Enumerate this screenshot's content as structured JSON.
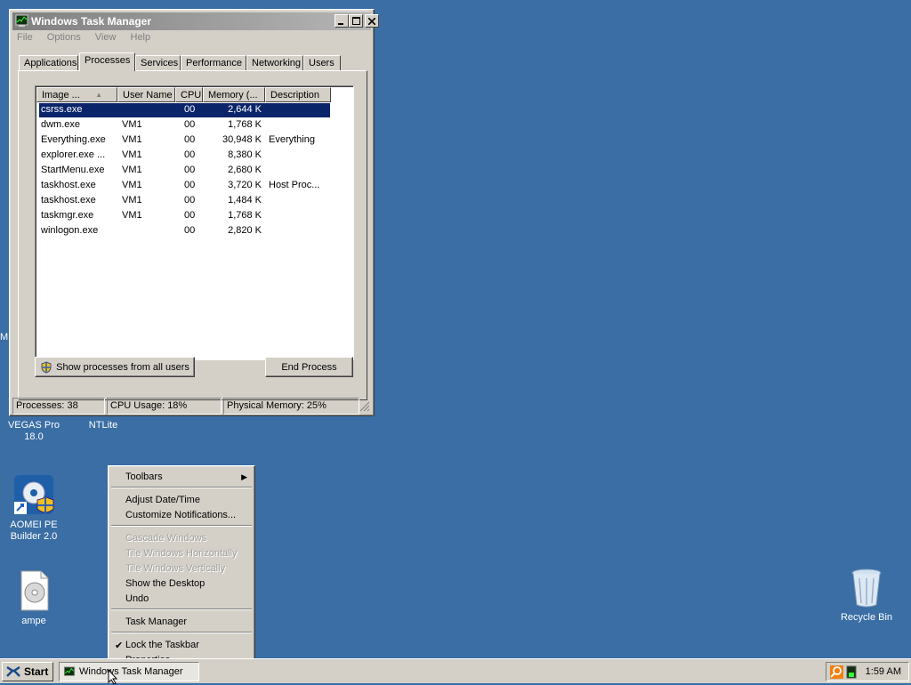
{
  "desktop": {
    "edge_letter": "M",
    "icons": [
      {
        "label_line1": "VEGAS Pro",
        "label_line2": "18.0"
      },
      {
        "label_line1": "NTLite",
        "label_line2": ""
      },
      {
        "label_line1": "AOMEI PE",
        "label_line2": "Builder 2.0"
      },
      {
        "label_line1": "ampe",
        "label_line2": ""
      },
      {
        "label_line1": "Recycle Bin",
        "label_line2": ""
      }
    ]
  },
  "window": {
    "title": "Windows Task Manager",
    "menu": [
      "File",
      "Options",
      "View",
      "Help"
    ],
    "tabs": [
      "Applications",
      "Processes",
      "Services",
      "Performance",
      "Networking",
      "Users"
    ],
    "active_tab": "Processes",
    "columns": [
      "Image ...",
      "User Name",
      "CPU",
      "Memory (...",
      "Description"
    ],
    "rows": [
      {
        "image": "csrss.exe",
        "user": "",
        "cpu": "00",
        "mem": "2,644 K",
        "desc": ""
      },
      {
        "image": "dwm.exe",
        "user": "VM1",
        "cpu": "00",
        "mem": "1,768 K",
        "desc": ""
      },
      {
        "image": "Everything.exe",
        "user": "VM1",
        "cpu": "00",
        "mem": "30,948 K",
        "desc": "Everything"
      },
      {
        "image": "explorer.exe ...",
        "user": "VM1",
        "cpu": "00",
        "mem": "8,380 K",
        "desc": ""
      },
      {
        "image": "StartMenu.exe",
        "user": "VM1",
        "cpu": "00",
        "mem": "2,680 K",
        "desc": ""
      },
      {
        "image": "taskhost.exe",
        "user": "VM1",
        "cpu": "00",
        "mem": "3,720 K",
        "desc": "Host Proc..."
      },
      {
        "image": "taskhost.exe",
        "user": "VM1",
        "cpu": "00",
        "mem": "1,484 K",
        "desc": ""
      },
      {
        "image": "taskmgr.exe",
        "user": "VM1",
        "cpu": "00",
        "mem": "1,768 K",
        "desc": ""
      },
      {
        "image": "winlogon.exe",
        "user": "",
        "cpu": "00",
        "mem": "2,820 K",
        "desc": ""
      }
    ],
    "show_all_button": "Show processes from all users",
    "end_process_button": "End Process",
    "status": {
      "processes": "Processes: 38",
      "cpu": "CPU Usage: 18%",
      "memory": "Physical Memory: 25%"
    }
  },
  "context_menu": {
    "toolbars": "Toolbars",
    "adjust_datetime": "Adjust Date/Time",
    "customize_notifications": "Customize Notifications...",
    "cascade": "Cascade Windows",
    "tile_h": "Tile Windows Horizontally",
    "tile_v": "Tile Windows Vertically",
    "show_desktop": "Show the Desktop",
    "undo": "Undo",
    "task_manager": "Task Manager",
    "lock_taskbar": "Lock the Taskbar",
    "properties": "Properties"
  },
  "taskbar": {
    "start_label": "Start",
    "task_label": "Windows Task Manager",
    "clock": "1:59 AM"
  },
  "colors": {
    "desktop": "#3a6ea5",
    "selection": "#0a246a",
    "face": "#d4d0c8"
  }
}
